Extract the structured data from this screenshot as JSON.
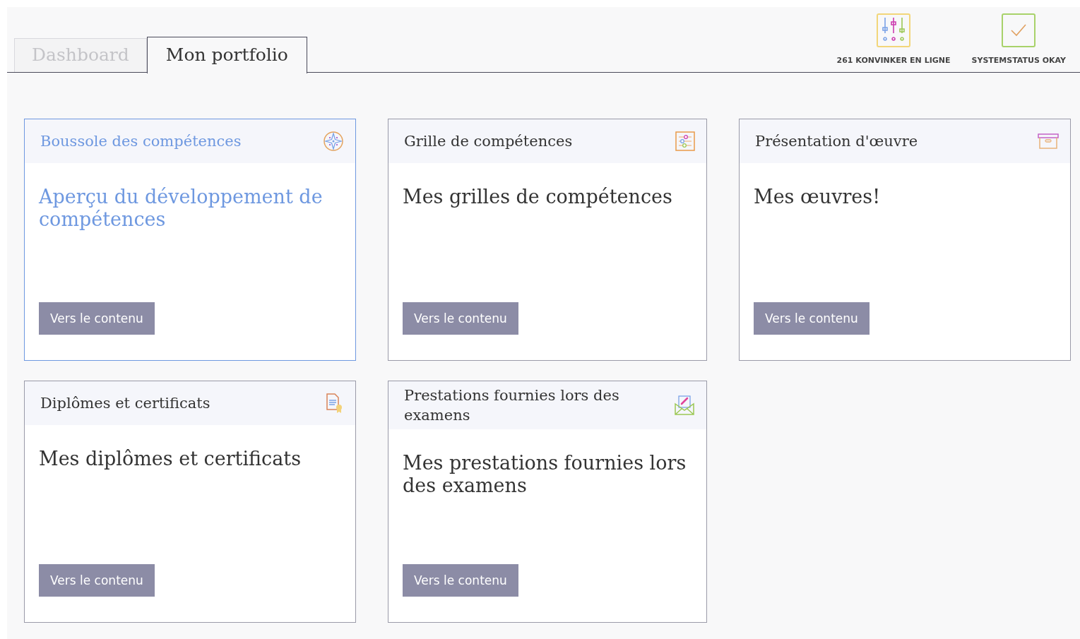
{
  "tabs": [
    {
      "label": "Dashboard",
      "selected": false
    },
    {
      "label": "Mon portfolio",
      "selected": true
    }
  ],
  "status": [
    {
      "kind": "sliders",
      "label": "261 KONVINKER EN LIGNE"
    },
    {
      "kind": "check",
      "label": "SYSTEMSTATUS OKAY"
    }
  ],
  "cards": [
    {
      "kind": "compass",
      "title": "Boussole des compétences",
      "text": "Aperçu du développement de compétences",
      "button": "Vers le contenu",
      "selected": true
    },
    {
      "kind": "grid",
      "title": "Grille de compétences",
      "text": "Mes grilles de compétences",
      "button": "Vers le contenu",
      "selected": false
    },
    {
      "kind": "box",
      "title": "Présentation d'œuvre",
      "text": "Mes œuvres!",
      "button": "Vers le contenu",
      "selected": false
    },
    {
      "kind": "certificate",
      "title": "Diplômes et certificats",
      "text": "Mes diplômes et certificats",
      "button": "Vers le contenu",
      "selected": false
    },
    {
      "kind": "mail",
      "title": "Prestations fournies lors des examens",
      "text": "Mes prestations fournies lors des examens",
      "button": "Vers le contenu",
      "selected": false
    }
  ]
}
